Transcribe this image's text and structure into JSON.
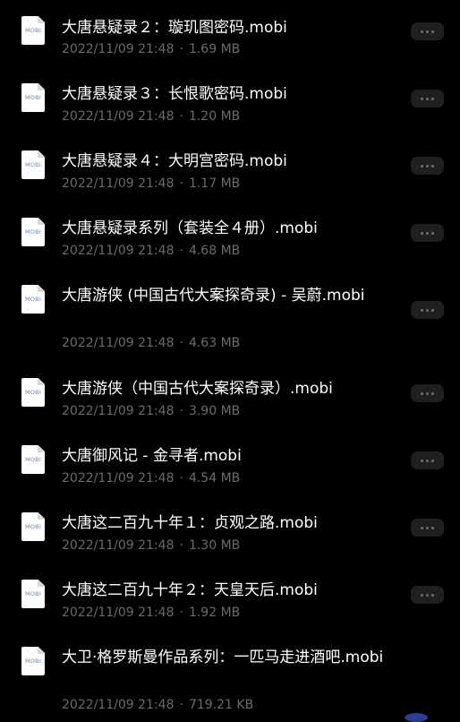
{
  "icon_label": "MOBI",
  "files": [
    {
      "name": "大唐悬疑录２：璇玑图密码.mobi",
      "date": "2022/11/09 21:48",
      "size": "1.69 MB"
    },
    {
      "name": "大唐悬疑录３：长恨歌密码.mobi",
      "date": "2022/11/09 21:48",
      "size": "1.20 MB"
    },
    {
      "name": "大唐悬疑录４：大明宫密码.mobi",
      "date": "2022/11/09 21:48",
      "size": "1.17 MB"
    },
    {
      "name": "大唐悬疑录系列（套装全４册）.mobi",
      "date": "2022/11/09 21:48",
      "size": "4.68 MB"
    },
    {
      "name": "大唐游侠 (中国古代大案探奇录) - 吴蔚.mobi",
      "date": "2022/11/09 21:48",
      "size": "4.63 MB"
    },
    {
      "name": "大唐游侠（中国古代大案探奇录）.mobi",
      "date": "2022/11/09 21:48",
      "size": "3.90 MB"
    },
    {
      "name": "大唐御风记 - 金寻者.mobi",
      "date": "2022/11/09 21:48",
      "size": "4.54 MB"
    },
    {
      "name": "大唐这二百九十年１：贞观之路.mobi",
      "date": "2022/11/09 21:48",
      "size": "1.30 MB"
    },
    {
      "name": "大唐这二百九十年２：天皇天后.mobi",
      "date": "2022/11/09 21:48",
      "size": "1.92 MB"
    },
    {
      "name": "大卫·格罗斯曼作品系列：一匹马走进酒吧.mobi",
      "date": "2022/11/09 21:48",
      "size": "719.21 KB"
    }
  ],
  "colors": {
    "background": "#000000",
    "name_text": "#ffffff",
    "meta_text": "#6b6b6b",
    "icon_tag": "#6f7fc9",
    "more_button_bg": "#1f1f1f"
  },
  "icons": {
    "file": "mobi-file-icon",
    "more": "more-icon"
  }
}
